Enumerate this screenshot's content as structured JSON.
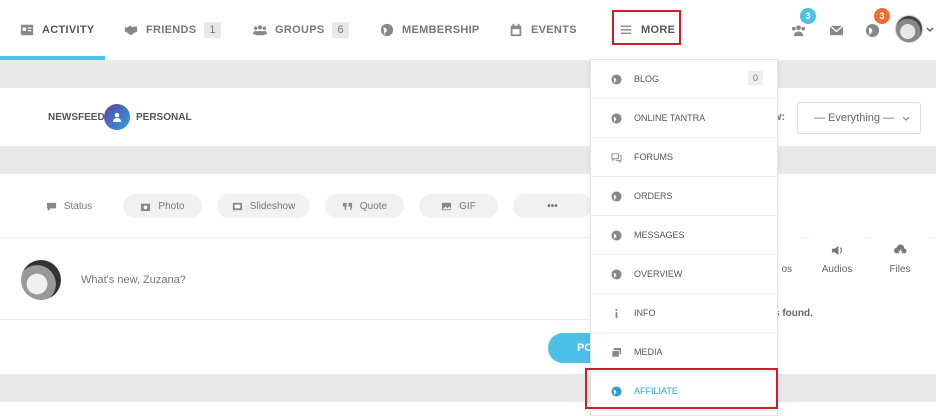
{
  "nav": {
    "items": [
      {
        "label": "ACTIVITY",
        "icon": "activity-card-icon"
      },
      {
        "label": "FRIENDS",
        "icon": "handshake-icon",
        "count": "1"
      },
      {
        "label": "GROUPS",
        "icon": "users-icon",
        "count": "6"
      },
      {
        "label": "MEMBERSHIP",
        "icon": "globe-icon"
      },
      {
        "label": "EVENTS",
        "icon": "calendar-icon"
      },
      {
        "label": "MORE",
        "icon": "hamburger-icon"
      }
    ],
    "friend_requests_badge": "3",
    "notifications_badge": "3",
    "accent_color": "#4dc0e8",
    "badge_blue": "#4dc0e8",
    "badge_orange": "#f26b3a"
  },
  "filter": {
    "newsfeed_label": "NEWSFEED",
    "personal_label": "PERSONAL",
    "show_label": "w:",
    "select_value": "— Everything —"
  },
  "post_types": [
    {
      "label": "Status",
      "icon": "speech-bubble-icon"
    },
    {
      "label": "Photo",
      "icon": "camera-icon"
    },
    {
      "label": "Slideshow",
      "icon": "slideshow-icon"
    },
    {
      "label": "Quote",
      "icon": "quote-icon"
    },
    {
      "label": "GIF",
      "icon": "image-icon"
    },
    {
      "label": "•••",
      "icon": ""
    }
  ],
  "post": {
    "placeholder": "What's new, Zuzana?",
    "button_label": "PO"
  },
  "media": {
    "videos_label": "os",
    "audios_label": "Audios",
    "files_label": "Files",
    "nothing_found": "s found."
  },
  "dropdown": {
    "items": [
      {
        "label": "BLOG",
        "icon": "globe-icon",
        "count": "0"
      },
      {
        "label": "ONLINE TANTRA",
        "icon": "globe-icon"
      },
      {
        "label": "FORUMS",
        "icon": "chat-bubbles-icon"
      },
      {
        "label": "ORDERS",
        "icon": "globe-icon"
      },
      {
        "label": "MESSAGES",
        "icon": "globe-icon"
      },
      {
        "label": "OVERVIEW",
        "icon": "globe-icon"
      },
      {
        "label": "INFO",
        "icon": "info-icon"
      },
      {
        "label": "MEDIA",
        "icon": "images-icon"
      },
      {
        "label": "AFFILIATE",
        "icon": "globe-icon",
        "active": true
      }
    ],
    "active_color": "#2d9fd8",
    "highlight_color": "#c8202a"
  }
}
